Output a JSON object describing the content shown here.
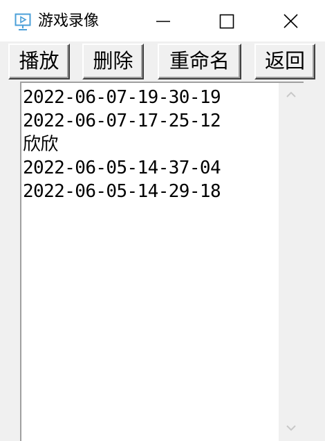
{
  "window": {
    "title": "游戏录像",
    "icon": "video-playback-icon"
  },
  "titlebar_controls": {
    "minimize_icon": "minimize-icon",
    "maximize_icon": "maximize-icon",
    "close_icon": "close-icon"
  },
  "toolbar": {
    "play_label": "播放",
    "delete_label": "删除",
    "rename_label": "重命名",
    "back_label": "返回"
  },
  "recordings": [
    "2022-06-07-19-30-19",
    "2022-06-07-17-25-12",
    "欣欣",
    "2022-06-05-14-37-04",
    "2022-06-05-14-29-18"
  ],
  "scrollbar": {
    "up_icon": "chevron-up-icon",
    "down_icon": "chevron-down-icon"
  }
}
